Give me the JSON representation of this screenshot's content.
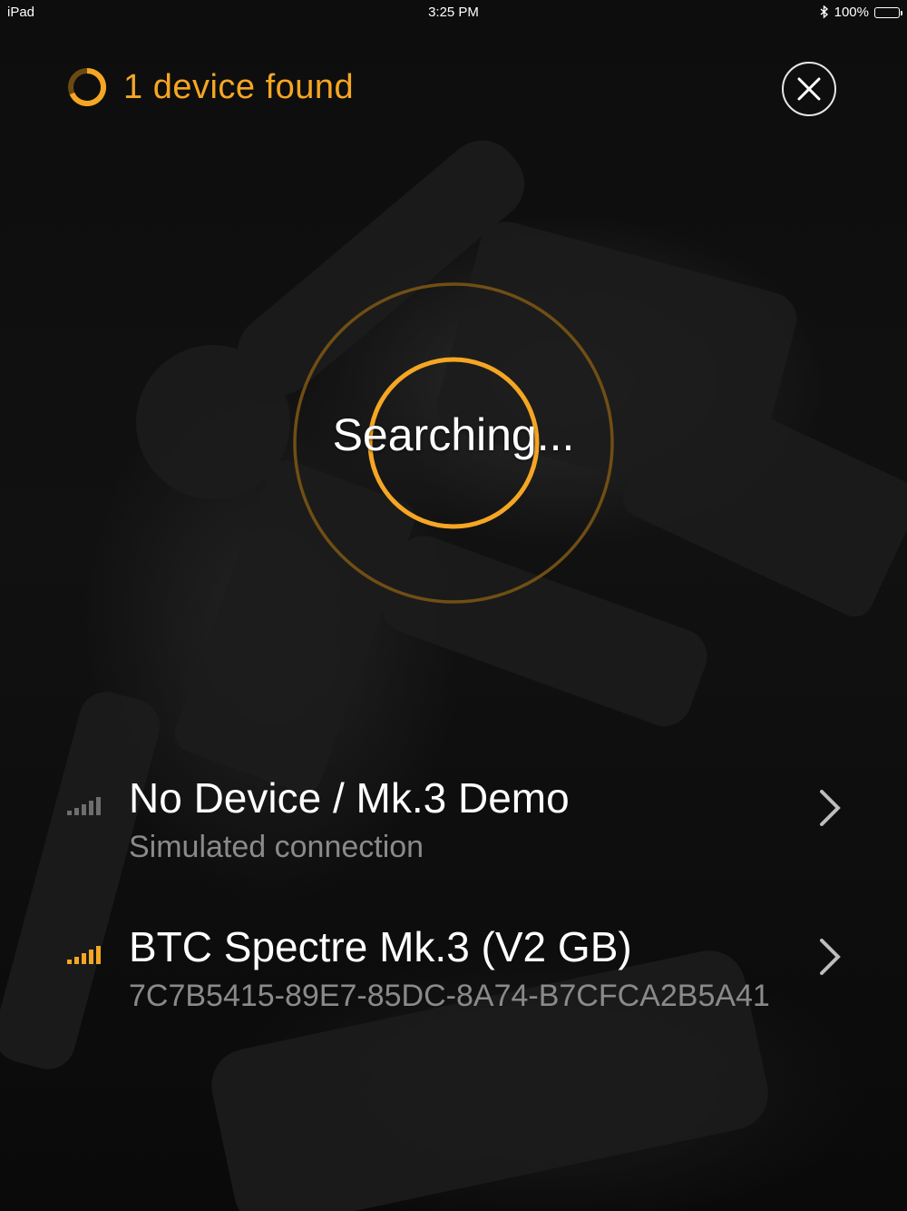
{
  "status_bar": {
    "device": "iPad",
    "time": "3:25 PM",
    "battery": "100%"
  },
  "header": {
    "found_label": "1 device found",
    "accent_color": "#f5a623"
  },
  "scan": {
    "label": "Searching..."
  },
  "devices": [
    {
      "name": "No Device / Mk.3 Demo",
      "detail": "Simulated connection",
      "signal_bars": 0
    },
    {
      "name": "BTC Spectre Mk.3 (V2 GB)",
      "detail": "7C7B5415-89E7-85DC-8A74-B7CFCA2B5A41",
      "signal_bars": 5
    }
  ],
  "icons": {
    "close": "close-icon",
    "spinner": "loading-ring-icon",
    "bluetooth": "bluetooth-icon",
    "battery": "battery-icon",
    "signal": "signal-strength-icon",
    "chevron": "chevron-right-icon"
  },
  "colors": {
    "accent": "#f5a623",
    "muted_text": "#8a8a8a",
    "inactive_signal": "#6e6e6e"
  }
}
